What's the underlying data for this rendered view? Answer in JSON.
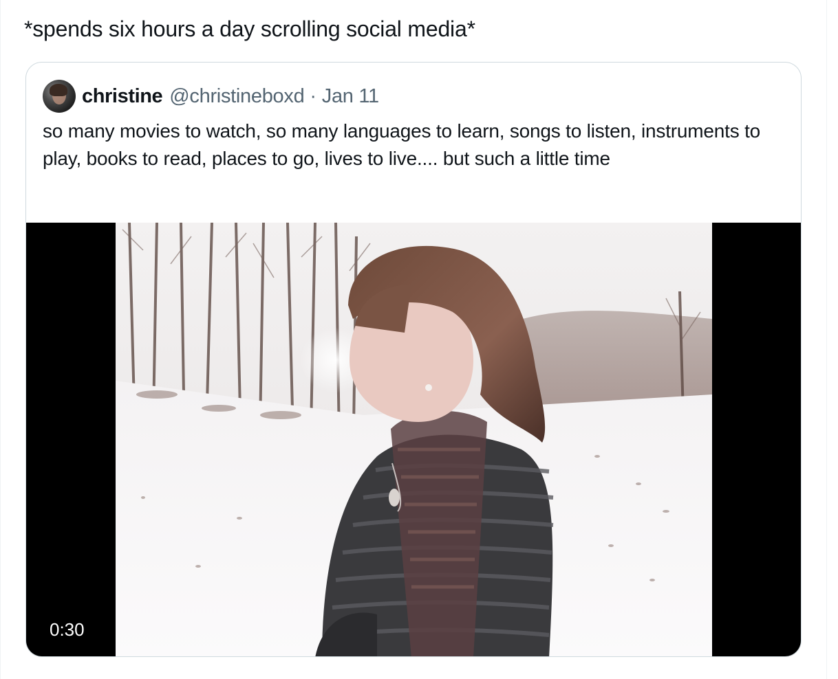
{
  "post": {
    "text": "*spends six hours a day scrolling social media*"
  },
  "quoted_post": {
    "author_name": "christine",
    "author_handle": "@christineboxd",
    "separator": "·",
    "date": "Jan 11",
    "body": "so many movies to watch, so many languages to learn, songs to listen, instruments to play, books to read, places to go, lives to live.... but such a little time",
    "video": {
      "duration": "0:30"
    }
  },
  "colors": {
    "text": "#0f1419",
    "secondary_text": "#536471",
    "card_border": "#cfd9de",
    "video_letterbox": "#000000"
  },
  "icons": {
    "avatar": "avatar-image"
  }
}
